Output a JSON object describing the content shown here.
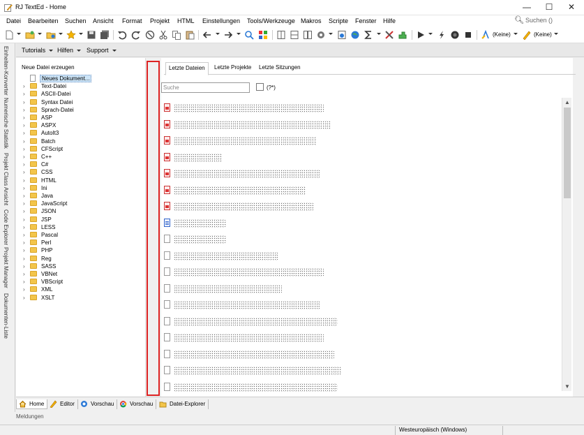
{
  "window": {
    "title": "RJ TextEd - Home",
    "minimize": "—",
    "maximize": "☐",
    "close": "✕"
  },
  "menu": [
    {
      "label": "Datei"
    },
    {
      "label": "Bearbeiten"
    },
    {
      "label": "Suchen"
    },
    {
      "label": "Ansicht"
    },
    {
      "label": "Format"
    },
    {
      "label": "Projekt"
    },
    {
      "label": "HTML"
    },
    {
      "label": "Einstellungen"
    },
    {
      "label": "Tools/Werkzeuge"
    },
    {
      "label": "Makros"
    },
    {
      "label": "Scripte"
    },
    {
      "label": "Fenster"
    },
    {
      "label": "Hilfe"
    }
  ],
  "search": {
    "placeholder": "Suchen ()"
  },
  "toolbar": {
    "highlighter_1": "(Keine)",
    "highlighter_2": "(Keine)"
  },
  "secondary_toolbar": {
    "tutorials": "Tutorials",
    "help": "Hilfen",
    "support": "Support"
  },
  "side_tabs": [
    "Einheiten-Konverter",
    "Numerische Statistik",
    "Projekt Class Ansicht",
    "Code Explorer",
    "Projekt Manager",
    "Dokumenten-Liste"
  ],
  "new_file": {
    "heading": "Neue Datei erzeugen",
    "items": [
      {
        "label": "Neues Dokument...",
        "type": "doc",
        "selected": true
      },
      {
        "label": "Text-Datei"
      },
      {
        "label": "ASCII-Datei"
      },
      {
        "label": "Syntax Datei"
      },
      {
        "label": "Sprach-Datei"
      },
      {
        "label": "ASP"
      },
      {
        "label": "ASPX"
      },
      {
        "label": "AutoIt3"
      },
      {
        "label": "Batch"
      },
      {
        "label": "CFScript"
      },
      {
        "label": "C++"
      },
      {
        "label": "C#"
      },
      {
        "label": "CSS"
      },
      {
        "label": "HTML"
      },
      {
        "label": "Ini"
      },
      {
        "label": "Java"
      },
      {
        "label": "JavaScript"
      },
      {
        "label": "JSON"
      },
      {
        "label": "JSP"
      },
      {
        "label": "LESS"
      },
      {
        "label": "Pascal"
      },
      {
        "label": "Perl"
      },
      {
        "label": "PHP"
      },
      {
        "label": "Reg"
      },
      {
        "label": "SASS"
      },
      {
        "label": "VBNet"
      },
      {
        "label": "VBScript"
      },
      {
        "label": "XML"
      },
      {
        "label": "XSLT"
      }
    ]
  },
  "recent": {
    "tabs": [
      {
        "label": "Letzte Dateien",
        "active": true
      },
      {
        "label": "Letzte Projekte"
      },
      {
        "label": "Letzte Sitzungen"
      }
    ],
    "search_placeholder": "Suche",
    "regex_label": "(?*)",
    "files": [
      {
        "icon": "html",
        "redacted_width": 215
      },
      {
        "icon": "html",
        "redacted_width": 225
      },
      {
        "icon": "html",
        "redacted_width": 205
      },
      {
        "icon": "html",
        "redacted_width": 70
      },
      {
        "icon": "html",
        "redacted_width": 210
      },
      {
        "icon": "html",
        "redacted_width": 190
      },
      {
        "icon": "html",
        "redacted_width": 200
      },
      {
        "icon": "code",
        "redacted_width": 75
      },
      {
        "icon": "doc",
        "redacted_width": 75
      },
      {
        "icon": "doc",
        "redacted_width": 150
      },
      {
        "icon": "doc",
        "redacted_width": 215
      },
      {
        "icon": "doc",
        "redacted_width": 155
      },
      {
        "icon": "doc",
        "redacted_width": 210
      },
      {
        "icon": "doc",
        "redacted_width": 235
      },
      {
        "icon": "doc",
        "redacted_width": 215
      },
      {
        "icon": "doc",
        "redacted_width": 230
      },
      {
        "icon": "doc",
        "redacted_width": 240
      },
      {
        "icon": "doc",
        "redacted_width": 235
      }
    ]
  },
  "bottom_tabs": [
    {
      "label": "Home",
      "icon": "home-icon",
      "active": true
    },
    {
      "label": "Editor",
      "icon": "pencil-icon"
    },
    {
      "label": "Vorschau",
      "icon": "ie-preview-icon"
    },
    {
      "label": "Vorschau",
      "icon": "chrome-preview-icon"
    },
    {
      "label": "Datei-Explorer",
      "icon": "file-explorer-icon"
    }
  ],
  "messages_label": "Meldungen",
  "status": {
    "encoding": "Westeuropäisch (Windows)"
  }
}
